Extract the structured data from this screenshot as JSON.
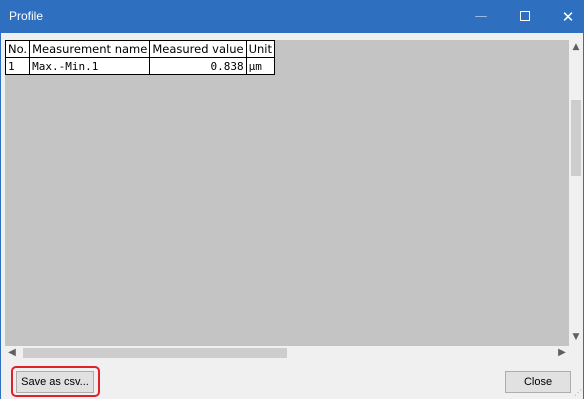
{
  "window": {
    "title": "Profile",
    "controls": {
      "minimize": "—",
      "close": "✕"
    }
  },
  "table": {
    "headers": [
      "No.",
      "Measurement name",
      "Measured value",
      "Unit"
    ],
    "rows": [
      [
        "1",
        "Max.-Min.1",
        "0.838",
        "μm"
      ]
    ]
  },
  "scroll": {
    "up": "▲",
    "down": "▼",
    "left": "◀",
    "right": "▶"
  },
  "buttons": {
    "save_csv": "Save as csv...",
    "close": "Close"
  },
  "colors": {
    "titlebar": "#2f6fbf",
    "highlight": "#e0202a",
    "content_bg": "#c4c4c4"
  }
}
